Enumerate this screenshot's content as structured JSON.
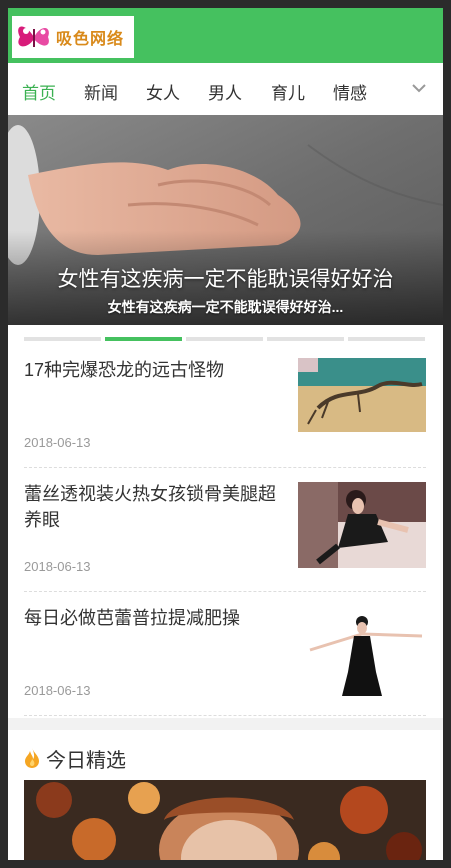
{
  "header": {
    "logo_text": "吸色网络",
    "logo_icon": "butterfly-icon",
    "brand_color": "#45c15f"
  },
  "nav": {
    "items": [
      "首页",
      "新闻",
      "女人",
      "男人",
      "育儿",
      "情感"
    ],
    "active_index": 0,
    "active_color": "#3bb152",
    "more_icon": "chevron-down-icon"
  },
  "hero": {
    "title": "女性有这疾病一定不能耽误得好好治",
    "subtitle": "女性有这疾病一定不能耽误得好好治...",
    "slide_count": 5,
    "active_slide": 1
  },
  "articles": [
    {
      "title": "17种完爆恐龙的远古怪物",
      "date": "2018-06-13"
    },
    {
      "title": "蕾丝透视装火热女孩锁骨美腿超养眼",
      "date": "2018-06-13"
    },
    {
      "title": "每日必做芭蕾普拉提减肥操",
      "date": "2018-06-13"
    }
  ],
  "featured": {
    "title": "今日精选",
    "icon": "flame-icon",
    "icon_color": "#f5a623"
  }
}
